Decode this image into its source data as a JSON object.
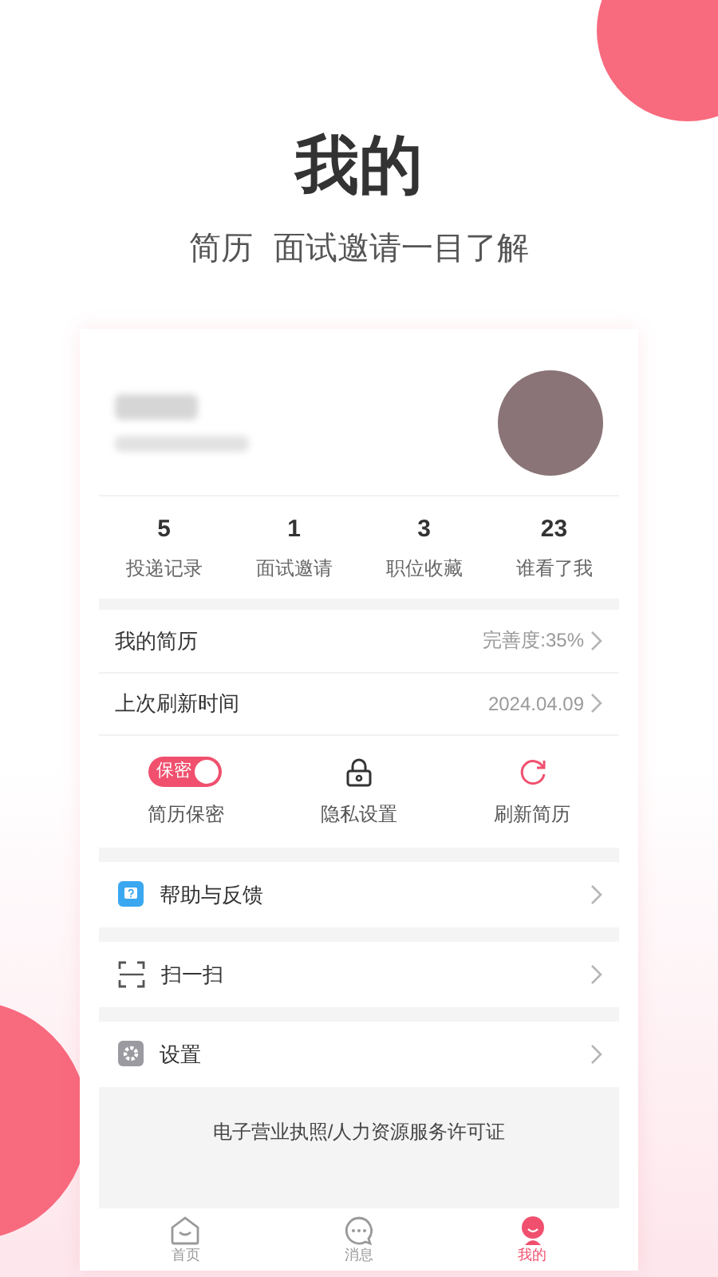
{
  "header": {
    "title": "我的",
    "subtitle": "简历  面试邀请一目了解"
  },
  "stats": [
    {
      "value": "5",
      "label": "投递记录"
    },
    {
      "value": "1",
      "label": "面试邀请"
    },
    {
      "value": "3",
      "label": "职位收藏"
    },
    {
      "value": "23",
      "label": "谁看了我"
    }
  ],
  "resume_rows": [
    {
      "label": "我的简历",
      "value": "完善度:35%"
    },
    {
      "label": "上次刷新时间",
      "value": "2024.04.09"
    }
  ],
  "actions": [
    {
      "kind": "toggle",
      "label": "简历保密",
      "toggle_text": "保密",
      "on": true
    },
    {
      "kind": "lock",
      "label": "隐私设置"
    },
    {
      "kind": "refresh",
      "label": "刷新简历"
    }
  ],
  "menu": [
    {
      "kind": "help",
      "label": "帮助与反馈"
    },
    {
      "kind": "scan",
      "label": "扫一扫"
    },
    {
      "kind": "settings",
      "label": "设置"
    }
  ],
  "license": "电子营业执照/人力资源服务许可证",
  "tab_bar": [
    {
      "kind": "home",
      "label": "首页",
      "selected": false
    },
    {
      "kind": "chat",
      "label": "消息",
      "selected": false
    },
    {
      "kind": "me",
      "label": "我的",
      "selected": true
    }
  ]
}
